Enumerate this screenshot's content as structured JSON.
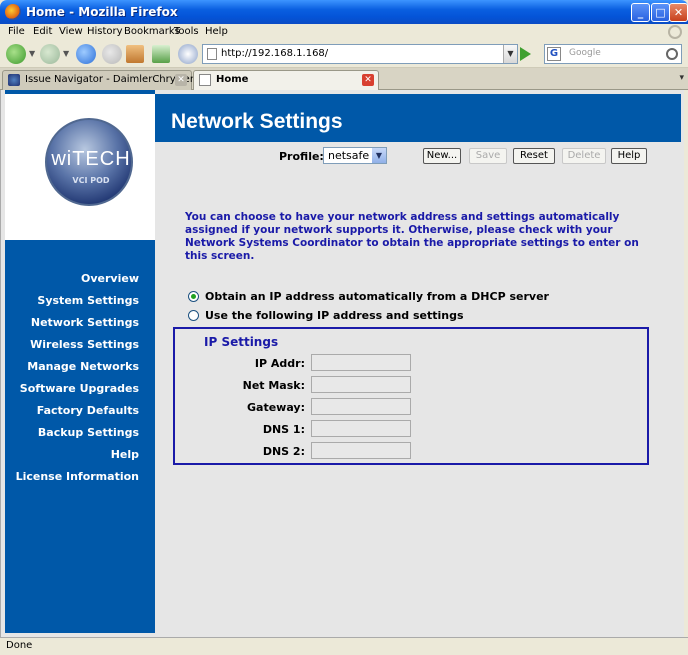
{
  "window": {
    "title": "Home - Mozilla Firefox",
    "minimize_glyph": "_",
    "maximize_glyph": "□",
    "close_glyph": "✕"
  },
  "menu": [
    "File",
    "Edit",
    "View",
    "History",
    "Bookmarks",
    "Tools",
    "Help"
  ],
  "toolbar": {
    "url": "http://192.168.1.168/",
    "search_placeholder": "Google",
    "search_engine_glyph": "G",
    "dropdown_glyph": "▼"
  },
  "tabs": [
    {
      "label": "Issue Navigator - DaimlerChrysler",
      "close_glyph": "✕"
    },
    {
      "label": "Home",
      "close_glyph": "✕"
    }
  ],
  "tab_list_glyph": "▾",
  "logo": {
    "brand": "wiTECH",
    "sub": "VCI POD"
  },
  "nav": [
    "Overview",
    "System Settings",
    "Network Settings",
    "Wireless Settings",
    "Manage Networks",
    "Software Upgrades",
    "Factory Defaults",
    "Backup Settings",
    "Help",
    "License Information"
  ],
  "page": {
    "title": "Network Settings",
    "profile_label": "Profile:",
    "profile_value": "netsafe",
    "profile_arrow": "▼",
    "buttons": {
      "new": "New...",
      "save": "Save",
      "reset": "Reset",
      "delete": "Delete",
      "help": "Help"
    },
    "intro": "You can choose to have your network address and settings automatically assigned if your network supports it.  Otherwise, please check with your Network Systems Coordinator to obtain the appropriate settings to enter on this screen.",
    "radio_dhcp": "Obtain an IP address automatically from a DHCP server",
    "radio_static": "Use the following IP address and settings",
    "ip_settings": {
      "title": "IP Settings",
      "fields": [
        {
          "label": "IP Addr:",
          "value": ""
        },
        {
          "label": "Net Mask:",
          "value": ""
        },
        {
          "label": "Gateway:",
          "value": ""
        },
        {
          "label": "DNS 1:",
          "value": ""
        },
        {
          "label": "DNS 2:",
          "value": ""
        }
      ]
    }
  },
  "status": "Done"
}
